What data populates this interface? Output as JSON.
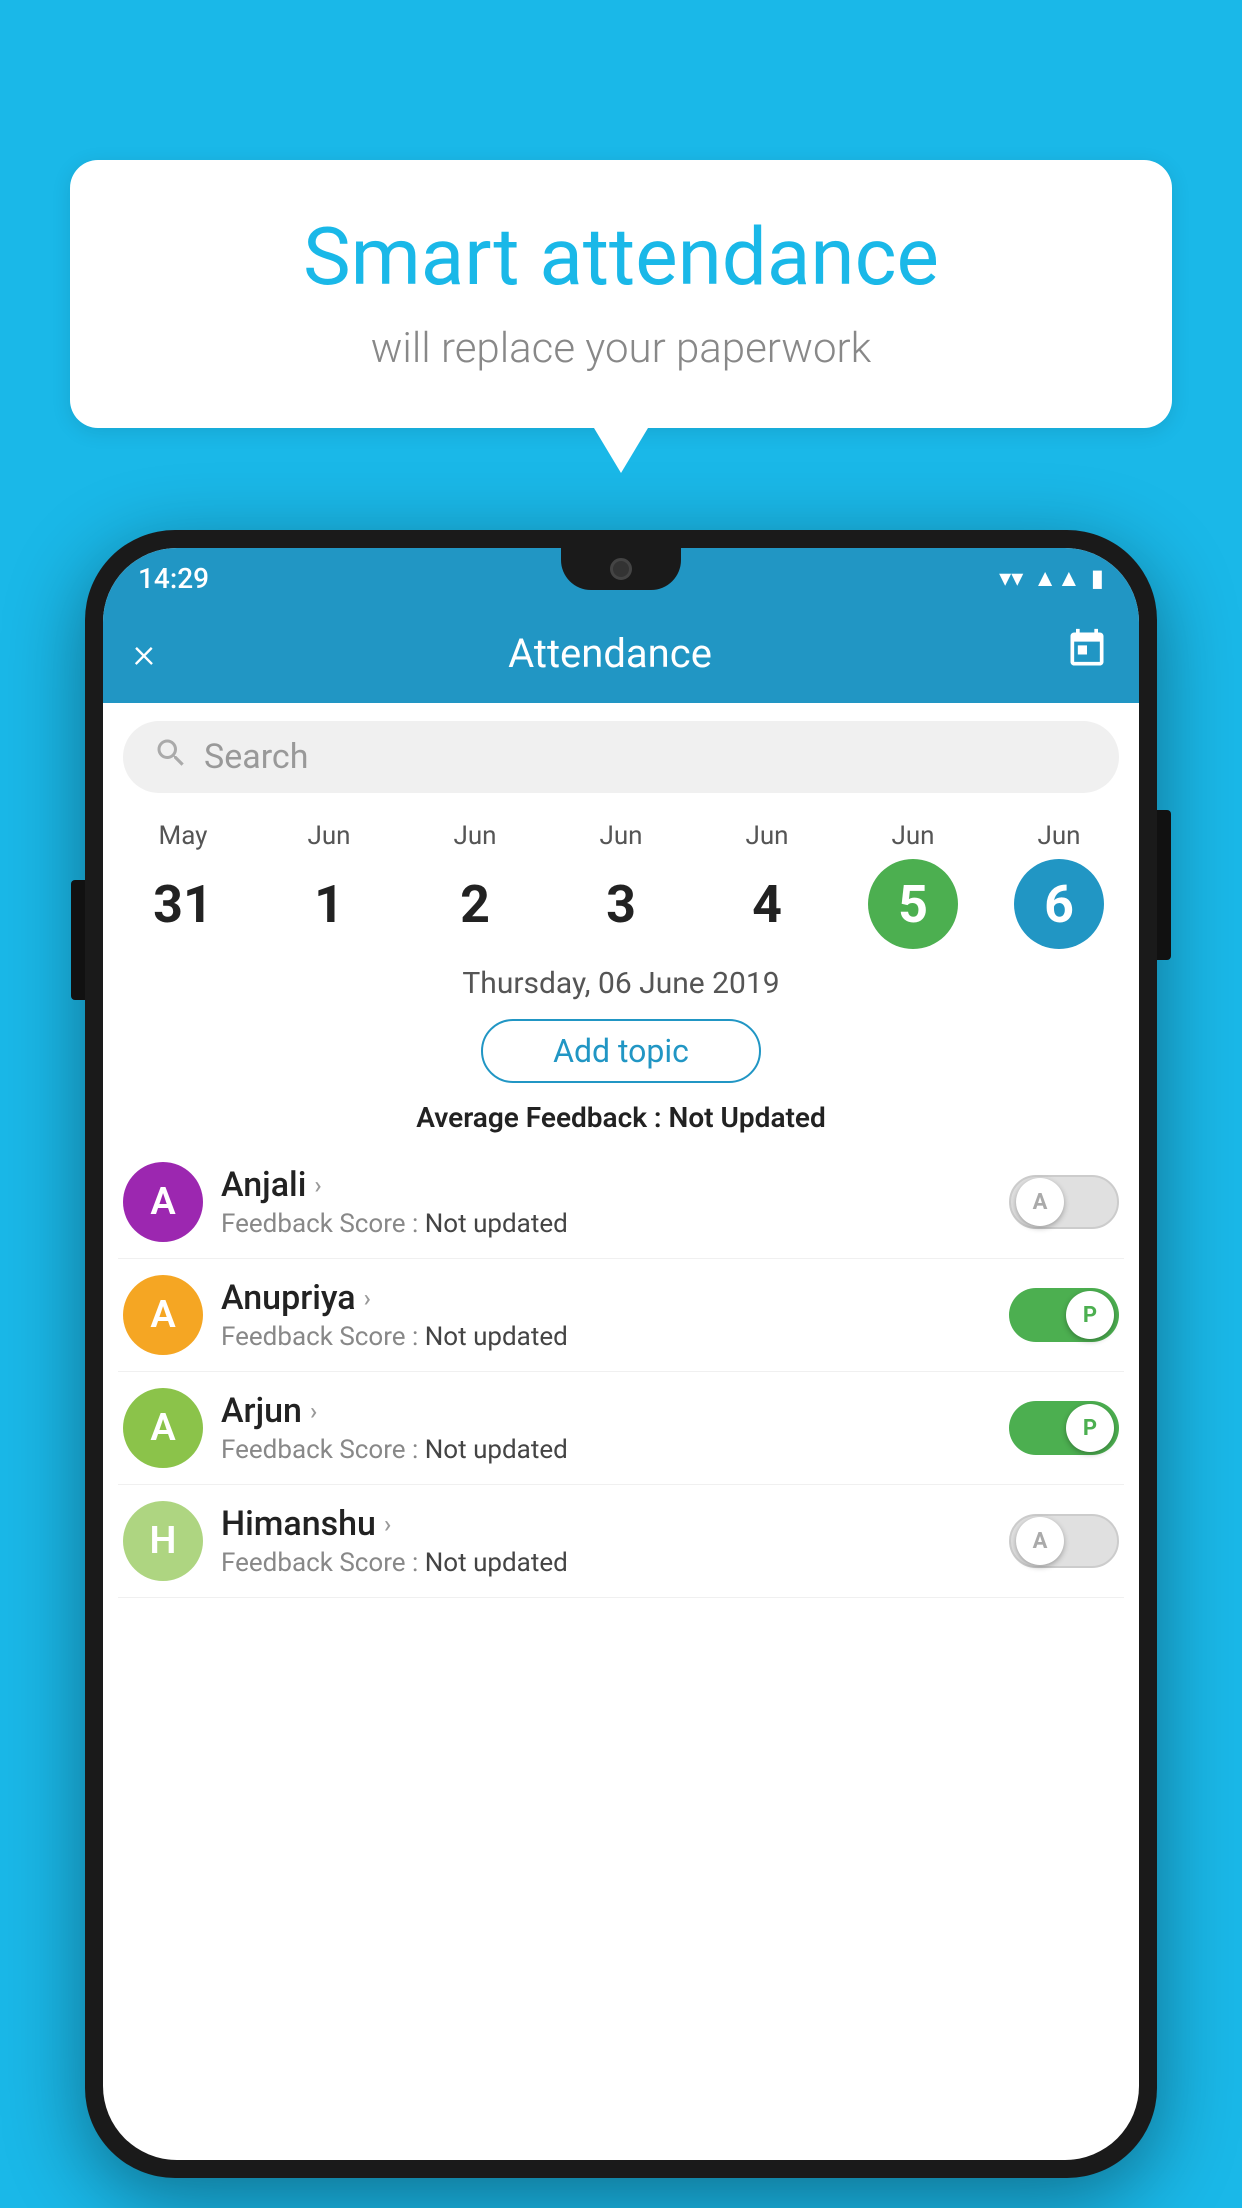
{
  "background": {
    "color": "#1ab8e8"
  },
  "speech_bubble": {
    "title": "Smart attendance",
    "subtitle": "will replace your paperwork"
  },
  "phone": {
    "status_bar": {
      "time": "14:29",
      "wifi": "▾",
      "signal": "▲",
      "battery": "▪"
    },
    "header": {
      "close_label": "×",
      "title": "Attendance",
      "calendar_icon": "📅"
    },
    "search": {
      "placeholder": "Search"
    },
    "calendar": {
      "days": [
        {
          "month": "May",
          "date": "31",
          "style": "normal"
        },
        {
          "month": "Jun",
          "date": "1",
          "style": "normal"
        },
        {
          "month": "Jun",
          "date": "2",
          "style": "normal"
        },
        {
          "month": "Jun",
          "date": "3",
          "style": "normal"
        },
        {
          "month": "Jun",
          "date": "4",
          "style": "normal"
        },
        {
          "month": "Jun",
          "date": "5",
          "style": "active-green"
        },
        {
          "month": "Jun",
          "date": "6",
          "style": "active-blue"
        }
      ]
    },
    "selected_date": "Thursday, 06 June 2019",
    "add_topic_label": "Add topic",
    "avg_feedback_label": "Average Feedback :",
    "avg_feedback_value": "Not Updated",
    "students": [
      {
        "name": "Anjali",
        "avatar_letter": "A",
        "avatar_color": "#9c27b0",
        "feedback_label": "Feedback Score :",
        "feedback_value": "Not updated",
        "toggle": "off",
        "toggle_letter": "A"
      },
      {
        "name": "Anupriya",
        "avatar_letter": "A",
        "avatar_color": "#f5a623",
        "feedback_label": "Feedback Score :",
        "feedback_value": "Not updated",
        "toggle": "on",
        "toggle_letter": "P"
      },
      {
        "name": "Arjun",
        "avatar_letter": "A",
        "avatar_color": "#8bc34a",
        "feedback_label": "Feedback Score :",
        "feedback_value": "Not updated",
        "toggle": "on",
        "toggle_letter": "P"
      },
      {
        "name": "Himanshu",
        "avatar_letter": "H",
        "avatar_color": "#aed581",
        "feedback_label": "Feedback Score :",
        "feedback_value": "Not updated",
        "toggle": "off",
        "toggle_letter": "A"
      }
    ]
  }
}
